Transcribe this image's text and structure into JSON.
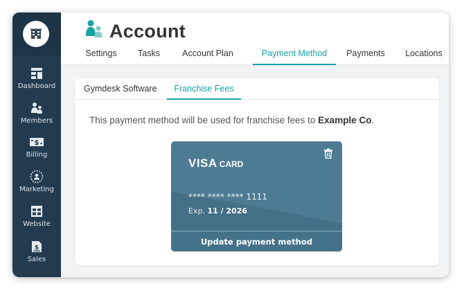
{
  "sidebar": {
    "logo_icon": "building-icon",
    "items": [
      {
        "label": "Dashboard",
        "icon": "dashboard-icon"
      },
      {
        "label": "Members",
        "icon": "members-icon"
      },
      {
        "label": "Billing",
        "icon": "billing-icon"
      },
      {
        "label": "Marketing",
        "icon": "marketing-icon"
      },
      {
        "label": "Website",
        "icon": "website-icon"
      },
      {
        "label": "Sales",
        "icon": "sales-icon"
      }
    ]
  },
  "header": {
    "title": "Account",
    "title_icon": "users-icon",
    "tabs": [
      {
        "label": "Settings"
      },
      {
        "label": "Tasks"
      },
      {
        "label": "Account Plan"
      },
      {
        "label": "Payment Method",
        "active": true
      },
      {
        "label": "Payments"
      },
      {
        "label": "Locations"
      }
    ]
  },
  "panel": {
    "sub_tabs": [
      {
        "label": "Gymdesk Software"
      },
      {
        "label": "Franchise Fees",
        "active": true
      }
    ],
    "message_prefix": "This payment method will be used for franchise fees to ",
    "message_company": "Example Co",
    "message_suffix": "."
  },
  "card": {
    "brand": "VISA",
    "brand_suffix": "CARD",
    "masked_prefix": "**** **** ****",
    "last4": "1111",
    "exp_label": "Exp.",
    "exp_value": "11 / 2026",
    "update_label": "Update payment method",
    "delete_icon": "trash-icon"
  },
  "colors": {
    "sidebar": "#243b4f",
    "accent": "#17a2a2",
    "card": "#4d7b94",
    "background": "#f1f3f5"
  }
}
